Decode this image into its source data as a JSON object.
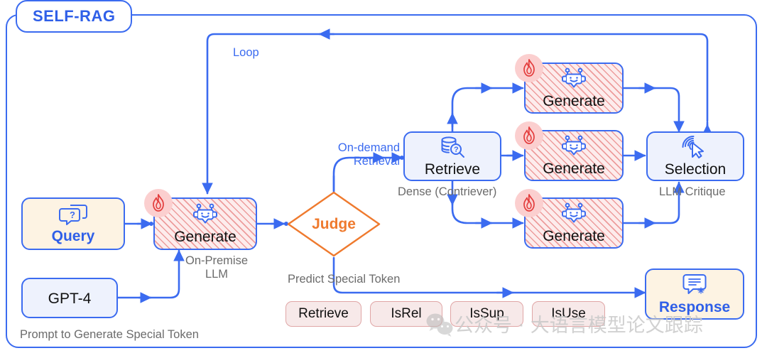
{
  "diagram": {
    "title": "SELF-RAG",
    "nodes": {
      "query": {
        "label": "Query",
        "icon": "question-speech-bubble-icon"
      },
      "gpt4": {
        "label": "GPT-4"
      },
      "generate_main": {
        "label": "Generate",
        "icon": "robot-icon",
        "badge": "flame-icon"
      },
      "judge": {
        "label": "Judge"
      },
      "retrieve": {
        "label": "Retrieve",
        "icon": "database-search-icon"
      },
      "generate_1": {
        "label": "Generate",
        "icon": "robot-icon",
        "badge": "flame-icon"
      },
      "generate_2": {
        "label": "Generate",
        "icon": "robot-icon",
        "badge": "flame-icon"
      },
      "generate_3": {
        "label": "Generate",
        "icon": "robot-icon",
        "badge": "flame-icon"
      },
      "selection": {
        "label": "Selection",
        "icon": "click-cursor-icon"
      },
      "response": {
        "label": "Response",
        "icon": "message-lines-icon"
      }
    },
    "captions": {
      "prompt_to_generate": "Prompt to Generate Special Token",
      "on_premise_llm": "On-Premise\nLLM",
      "dense_contriever": "Dense (Contriever)",
      "llm_critique": "LLM Critique",
      "predict_special_token": "Predict Special Token"
    },
    "edge_labels": {
      "loop": "Loop",
      "on_demand_retrieval": "On-demand\nRetrieval"
    },
    "special_tokens": [
      "Retrieve",
      "IsRel",
      "IsSup",
      "IsUse"
    ],
    "watermark": {
      "text": "公众号 · 大语言模型论文跟踪",
      "logo": "wechat-icon"
    },
    "colors": {
      "blue": "#3b6bf0",
      "blue_text": "#2f5fe8",
      "orange": "#ef7a2e",
      "cream": "#fdf3e3",
      "light_blue": "#eef2fd",
      "hatch_red": "#e05a5a",
      "chip_bg": "#f7e9e9",
      "chip_border": "#e0a6a6",
      "gray_text": "#6b6b6b"
    }
  }
}
